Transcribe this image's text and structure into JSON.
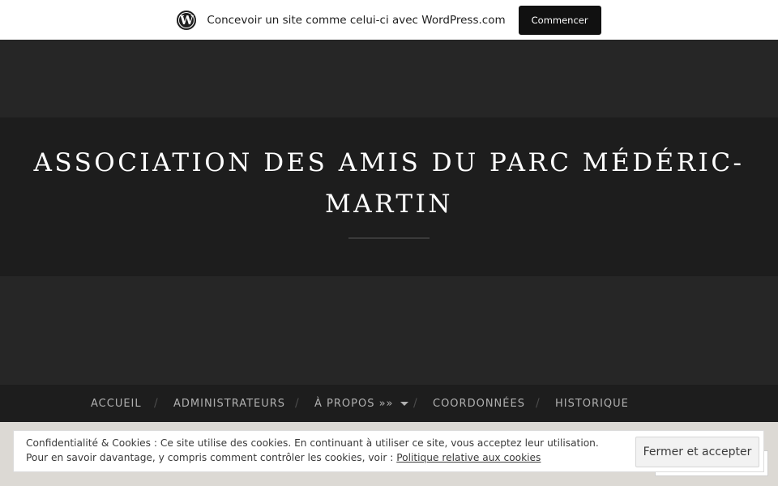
{
  "wp_bar": {
    "logo_icon": "wordpress-logo-icon",
    "logo_glyph": "W",
    "text": "Concevoir un site comme celui-ci avec WordPress.com",
    "button_label": "Commencer"
  },
  "site": {
    "title": "ASSOCIATION DES AMIS DU PARC MÉDÉRIC-MARTIN"
  },
  "nav": {
    "items": [
      {
        "label": "ACCUEIL"
      },
      {
        "label": "ADMINISTRATEURS"
      },
      {
        "label": "À PROPOS »»",
        "has_dropdown": true
      },
      {
        "label": "COORDONNÉES"
      },
      {
        "label": "HISTORIQUE"
      }
    ],
    "separator": "/"
  },
  "cookie_banner": {
    "line1": "Confidentialité & Cookies : Ce site utilise des cookies. En continuant à utiliser ce site, vous acceptez leur utilisation.",
    "line2_prefix": "Pour en savoir davantage, y compris comment contrôler les cookies, voir : ",
    "link_label": "Politique relative aux cookies",
    "button_label": "Fermer et accepter"
  },
  "colors": {
    "header_bg": "#262626",
    "title_band_bg": "#1d1d1d",
    "nav_text": "#b0b0b0"
  }
}
